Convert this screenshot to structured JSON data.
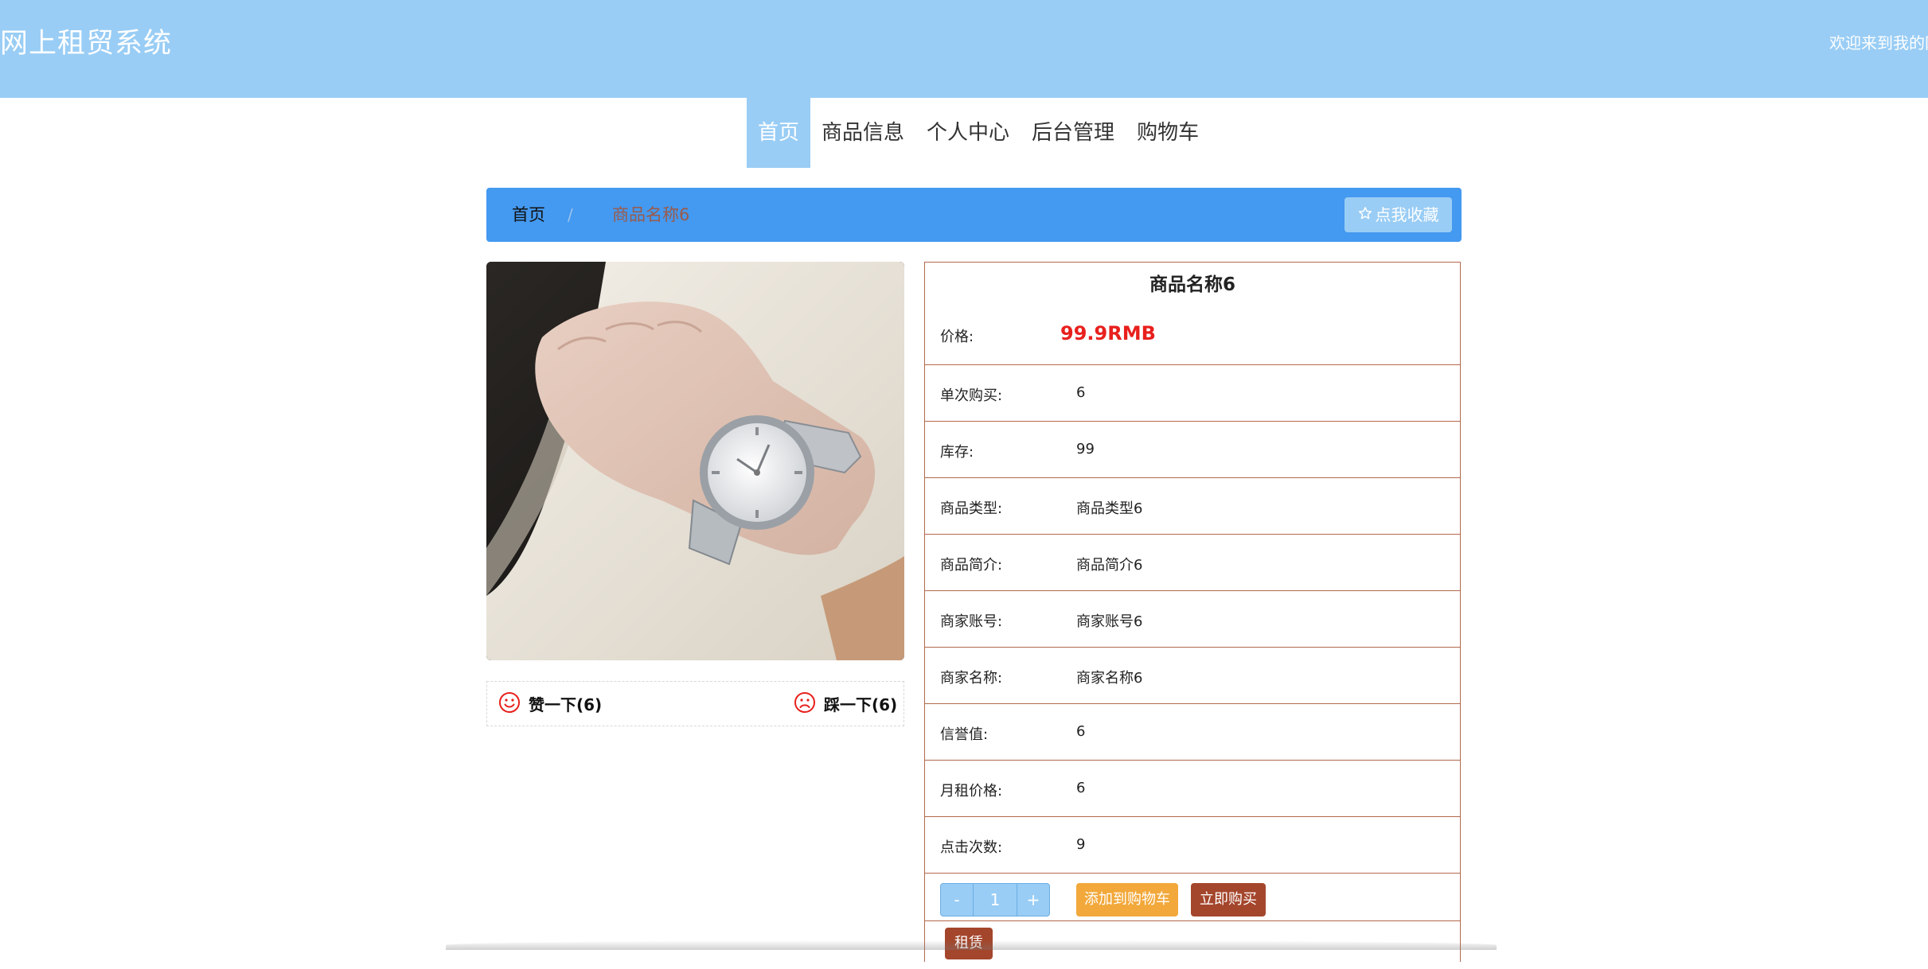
{
  "header": {
    "site_title": "网上租贸系统",
    "welcome_text": "欢迎来到我的网"
  },
  "nav": {
    "items": [
      {
        "label": "首页",
        "active": true
      },
      {
        "label": "商品信息"
      },
      {
        "label": "个人中心"
      },
      {
        "label": "后台管理"
      },
      {
        "label": "购物车"
      }
    ]
  },
  "breadcrumb": {
    "home": "首页",
    "separator": "/",
    "current": "商品名称6"
  },
  "favorite_button": "点我收藏",
  "product": {
    "name": "商品名称6",
    "price_label": "价格:",
    "price": "99.9RMB",
    "fields": [
      {
        "label": "单次购买:",
        "value": "6"
      },
      {
        "label": "库存:",
        "value": "99"
      },
      {
        "label": "商品类型:",
        "value": "商品类型6"
      },
      {
        "label": "商品简介:",
        "value": "商品简介6"
      },
      {
        "label": "商家账号:",
        "value": "商家账号6"
      },
      {
        "label": "商家名称:",
        "value": "商家名称6"
      },
      {
        "label": "信誉值:",
        "value": "6"
      },
      {
        "label": "月租价格:",
        "value": "6"
      },
      {
        "label": "点击次数:",
        "value": "9"
      }
    ]
  },
  "votes": {
    "like": "赞一下(6)",
    "dislike": "踩一下(6)"
  },
  "quantity": {
    "minus": "-",
    "value": "1",
    "plus": "+"
  },
  "actions": {
    "add_to_cart": "添加到购物车",
    "buy_now": "立即购买",
    "rent": "租赁"
  },
  "colors": {
    "header_bg": "#99cdf5",
    "breadcrumb_bg": "#4499f0",
    "price": "#e8201d",
    "border": "#b3694c",
    "add_cart": "#f2a83a",
    "buy": "#a4462c"
  },
  "icons": {
    "favorite": "star-outline-icon",
    "like": "smile-icon",
    "dislike": "frown-icon"
  }
}
